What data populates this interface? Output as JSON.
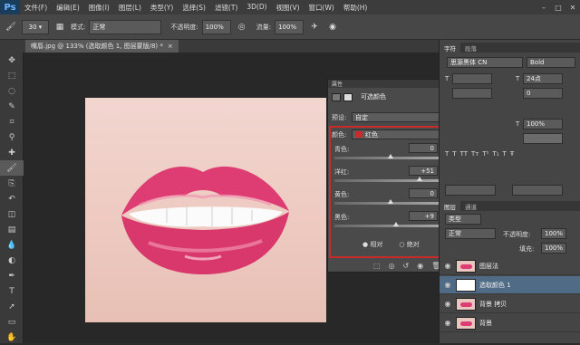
{
  "app": {
    "logo": "Ps"
  },
  "menus": [
    "文件(F)",
    "编辑(E)",
    "图像(I)",
    "图层(L)",
    "类型(Y)",
    "选择(S)",
    "滤镜(T)",
    "3D(D)",
    "视图(V)",
    "窗口(W)",
    "帮助(H)"
  ],
  "window_controls": {
    "minimize": "–",
    "maximize": "□",
    "close": "✕"
  },
  "options_bar": {
    "brush_size": "30",
    "mode_label": "模式:",
    "mode_value": "正常",
    "opacity_label": "不透明度:",
    "opacity_value": "100%",
    "flow_label": "流量:",
    "flow_value": "100%"
  },
  "document": {
    "tab_title": "嘴唇.jpg @ 133% (选取颜色 1, 图层蒙版/8) *",
    "close": "×"
  },
  "toolbox": {
    "icons": [
      "move-icon",
      "marquee-icon",
      "lasso-icon",
      "quick-select-icon",
      "crop-icon",
      "eyedropper-icon",
      "healing-icon",
      "brush-icon",
      "clone-stamp-icon",
      "history-brush-icon",
      "eraser-icon",
      "gradient-icon",
      "blur-icon",
      "dodge-icon",
      "pen-icon",
      "type-icon",
      "path-select-icon",
      "shape-icon",
      "hand-icon"
    ]
  },
  "properties": {
    "header": "属性",
    "title": "可选颜色",
    "preset_label": "预设:",
    "preset_value": "自定",
    "colors_label": "颜色:",
    "colors_value": "红色",
    "sliders": [
      {
        "label": "青色:",
        "value": "0",
        "unit": "%",
        "level": 0
      },
      {
        "label": "洋红:",
        "value": "+51",
        "unit": "%",
        "level": 51
      },
      {
        "label": "黄色:",
        "value": "0",
        "unit": "%",
        "level": 0
      },
      {
        "label": "黑色:",
        "value": "+9",
        "unit": "%",
        "level": 9
      }
    ],
    "method_relative": "相对",
    "method_absolute": "绝对"
  },
  "character_panel": {
    "tabs": [
      "字符",
      "段落"
    ],
    "font_family": "思源黑体 CN",
    "font_style": "Bold",
    "font_size": "24点",
    "tracking": "0",
    "scale": "100%"
  },
  "layers_panel": {
    "tabs": [
      "图层",
      "通道"
    ],
    "kind_value": "类型",
    "blend_mode": "正常",
    "opacity_label": "不透明度:",
    "opacity_value": "100%",
    "fill_label": "填充:",
    "fill_value": "100%",
    "layers": [
      {
        "name": "图层法",
        "selected": false
      },
      {
        "name": "选取颜色 1",
        "selected": true
      },
      {
        "name": "背景 拷贝",
        "selected": false
      },
      {
        "name": "背景",
        "selected": false
      }
    ]
  },
  "colors": {
    "lip": "#dd3d72",
    "highlight": "#c92a2a",
    "panel": "#4a4a4a"
  }
}
